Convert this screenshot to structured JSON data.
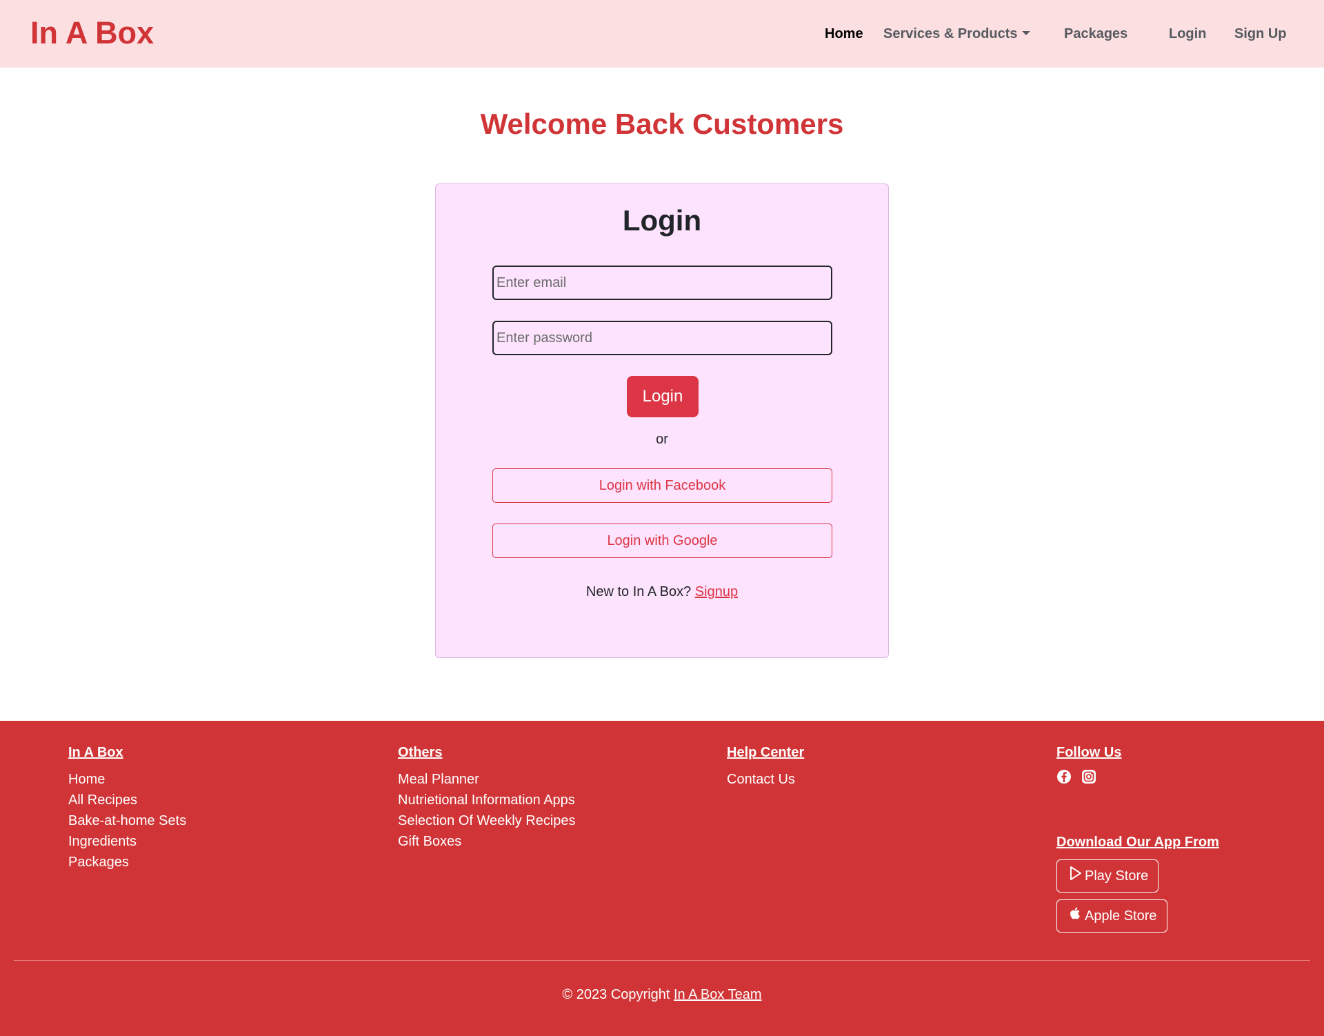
{
  "navbar": {
    "brand": "In A Box",
    "links": {
      "home": "Home",
      "services": "Services & Products",
      "packages": "Packages",
      "login": "Login",
      "signup": "Sign Up"
    }
  },
  "main": {
    "welcome": "Welcome Back Customers",
    "card": {
      "title": "Login",
      "email_placeholder": "Enter email",
      "password_placeholder": "Enter password",
      "login_button": "Login",
      "or_text": "or",
      "facebook_button": "Login with Facebook",
      "google_button": "Login with Google",
      "new_prompt": "New to In A Box?",
      "signup_link": "Signup"
    }
  },
  "footer": {
    "col1": {
      "heading": "In A Box",
      "links": [
        "Home",
        "All Recipes",
        "Bake-at-home Sets",
        "Ingredients",
        "Packages"
      ]
    },
    "col2": {
      "heading": "Others",
      "links": [
        "Meal Planner",
        "Nutrietional Information Apps",
        "Selection Of Weekly Recipes",
        "Gift Boxes"
      ]
    },
    "col3": {
      "heading": "Help Center",
      "links": [
        "Contact Us"
      ]
    },
    "col4": {
      "heading": "Follow Us",
      "icons": [
        "facebook-icon",
        "instagram-icon"
      ],
      "download_heading": "Download Our App From",
      "play_store": "Play Store",
      "apple_store": "Apple Store"
    },
    "copyright_prefix": "© 2023 Copyright",
    "copyright_link": "In A Box Team"
  },
  "colors": {
    "brand_red": "#d03436",
    "button_red": "#dc3545",
    "navbar_bg": "#fcdfe1",
    "card_bg": "#fde3fd"
  }
}
